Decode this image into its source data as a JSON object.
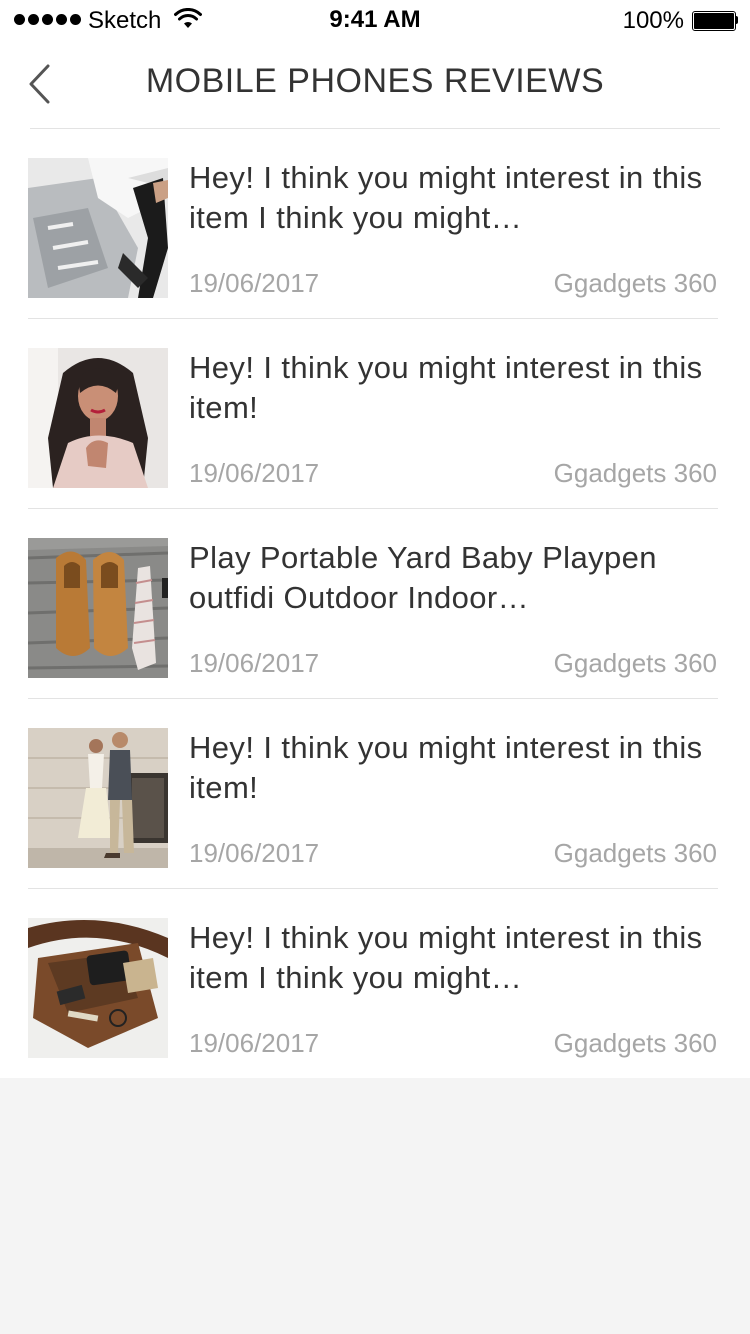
{
  "status_bar": {
    "carrier": "Sketch",
    "time": "9:41 AM",
    "battery": "100%"
  },
  "nav": {
    "title": "MOBILE PHONES REVIEWS",
    "back_icon": "chevron-left-icon"
  },
  "articles": [
    {
      "title": "Hey! I think you might interest in this item I think you might…",
      "date": "19/06/2017",
      "source": "Ggadgets 360",
      "image": "jeans-heels-photo"
    },
    {
      "title": "Hey! I think you might interest in this item!",
      "date": "19/06/2017",
      "source": "Ggadgets 360",
      "image": "woman-portrait-photo"
    },
    {
      "title": "Play Portable Yard Baby Playpen outfidi Outdoor Indoor…",
      "date": "19/06/2017",
      "source": "Ggadgets 360",
      "image": "shoes-tie-photo"
    },
    {
      "title": "Hey! I think you might interest in this item!",
      "date": "19/06/2017",
      "source": "Ggadgets 360",
      "image": "couple-walking-photo"
    },
    {
      "title": "Hey! I think you might interest in this item I think you might…",
      "date": "19/06/2017",
      "source": "Ggadgets 360",
      "image": "leather-bag-photo"
    }
  ]
}
